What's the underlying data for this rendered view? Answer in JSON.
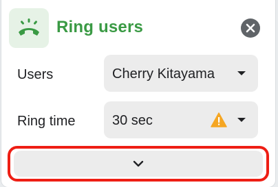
{
  "dialog": {
    "title": "Ring users",
    "icon": "phone-ringing-icon",
    "accent_color": "#3a9a44",
    "close_icon": "close-icon"
  },
  "fields": {
    "users": {
      "label": "Users",
      "value": "Cherry Kitayama"
    },
    "ring_time": {
      "label": "Ring time",
      "value": "30 sec",
      "status_icon": "warning-icon",
      "status_color": "#f5a623"
    }
  },
  "footer": {
    "expand_icon": "chevron-down-icon",
    "highlight_color": "#ee1e14"
  }
}
